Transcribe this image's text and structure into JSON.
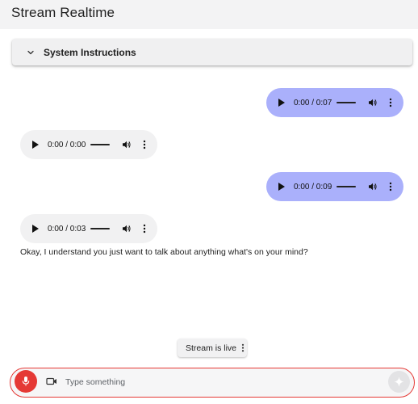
{
  "app": {
    "title": "Stream Realtime"
  },
  "system_instructions": {
    "label": "System Instructions",
    "icon": "chevron-down-icon"
  },
  "messages": [
    {
      "role": "user",
      "type": "audio",
      "time": "0:00 / 0:07"
    },
    {
      "role": "model",
      "type": "audio",
      "time": "0:00 / 0:00"
    },
    {
      "role": "user",
      "type": "audio",
      "time": "0:00 / 0:09"
    },
    {
      "role": "model",
      "type": "audio",
      "time": "0:00 / 0:03"
    },
    {
      "role": "model",
      "type": "text",
      "text": "Okay, I understand you just want to talk about anything what's on your mind?"
    }
  ],
  "stream_status": {
    "label": "Stream is live",
    "icon": "more-vert-icon"
  },
  "composer": {
    "placeholder": "Type something",
    "mic_icon": "mic-icon",
    "camera_icon": "videocam-icon",
    "send_icon": "sparkle-send-icon"
  },
  "colors": {
    "user_bubble": "#aab0fb",
    "model_bubble": "#f1f1f2",
    "mic_active": "#e53935",
    "input_border": "#e53935"
  }
}
